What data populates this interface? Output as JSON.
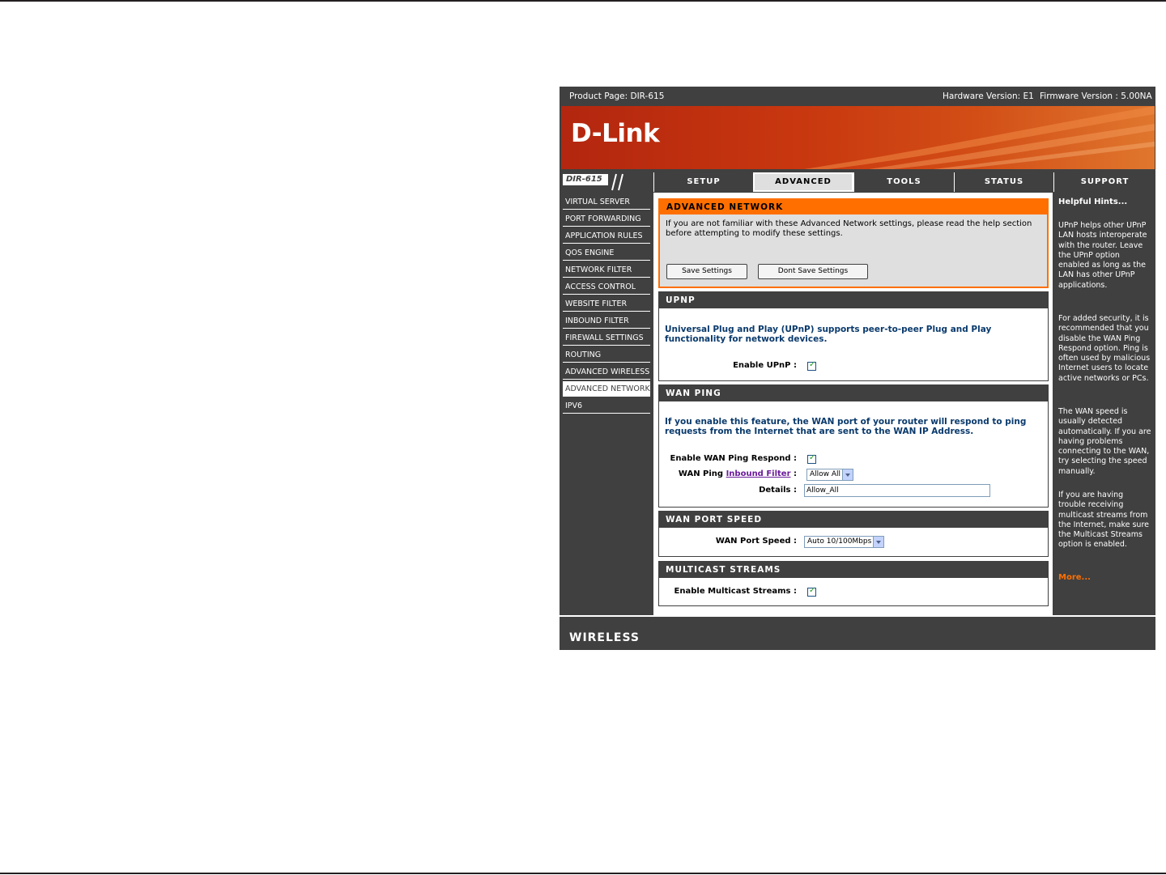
{
  "topbar": {
    "product": "Product Page: DIR-615",
    "hardware": "Hardware Version: E1",
    "firmware": "Firmware Version : 5.00NA"
  },
  "brand": {
    "logo": "D-Link",
    "model": "DIR-615",
    "footer": "WIRELESS"
  },
  "tabs": [
    {
      "label": "SETUP"
    },
    {
      "label": "ADVANCED"
    },
    {
      "label": "TOOLS"
    },
    {
      "label": "STATUS"
    },
    {
      "label": "SUPPORT"
    }
  ],
  "sidebar": {
    "items": [
      {
        "label": "VIRTUAL SERVER"
      },
      {
        "label": "PORT FORWARDING"
      },
      {
        "label": "APPLICATION RULES"
      },
      {
        "label": "QOS ENGINE"
      },
      {
        "label": "NETWORK FILTER"
      },
      {
        "label": "ACCESS CONTROL"
      },
      {
        "label": "WEBSITE FILTER"
      },
      {
        "label": "INBOUND FILTER"
      },
      {
        "label": "FIREWALL SETTINGS"
      },
      {
        "label": "ROUTING"
      },
      {
        "label": "ADVANCED WIRELESS"
      },
      {
        "label": "ADVANCED NETWORK"
      },
      {
        "label": "IPV6"
      }
    ]
  },
  "intro": {
    "title": "ADVANCED NETWORK",
    "text": "If you are not familiar with these Advanced Network settings, please read the help section before attempting to modify these settings.",
    "save": "Save Settings",
    "dont_save": "Dont Save Settings"
  },
  "upnp": {
    "title": "UPNP",
    "description": "Universal Plug and Play (UPnP) supports peer-to-peer Plug and Play functionality for network devices.",
    "enable_label": "Enable UPnP :"
  },
  "wan_ping": {
    "title": "WAN PING",
    "description": "If you enable this feature, the WAN port of your router will respond to ping requests from the Internet that are sent to the WAN IP Address.",
    "enable_label": "Enable WAN Ping Respond :",
    "filter_label_pre": "WAN Ping",
    "filter_link": "Inbound Filter",
    "filter_label_post": ":",
    "filter_value": "Allow All",
    "details_label": "Details :",
    "details_value": "Allow_All"
  },
  "wan_port": {
    "title": "WAN PORT SPEED",
    "label": "WAN Port Speed :",
    "value": "Auto 10/100Mbps"
  },
  "multicast": {
    "title": "MULTICAST STREAMS",
    "label": "Enable Multicast Streams :"
  },
  "hints": {
    "title": "Helpful Hints...",
    "items": [
      "UPnP helps other UPnP LAN hosts interoperate with the router. Leave the UPnP option enabled as long as the LAN has other UPnP applications.",
      "For added security, it is recommended that you disable the WAN Ping Respond option. Ping is often used by malicious Internet users to locate active networks or PCs.",
      "The WAN speed is usually detected automatically. If you are having problems connecting to the WAN, try selecting the speed manually.",
      "If you are having trouble receiving multicast streams from the Internet, make sure the Multicast Streams option is enabled."
    ],
    "more": "More..."
  }
}
